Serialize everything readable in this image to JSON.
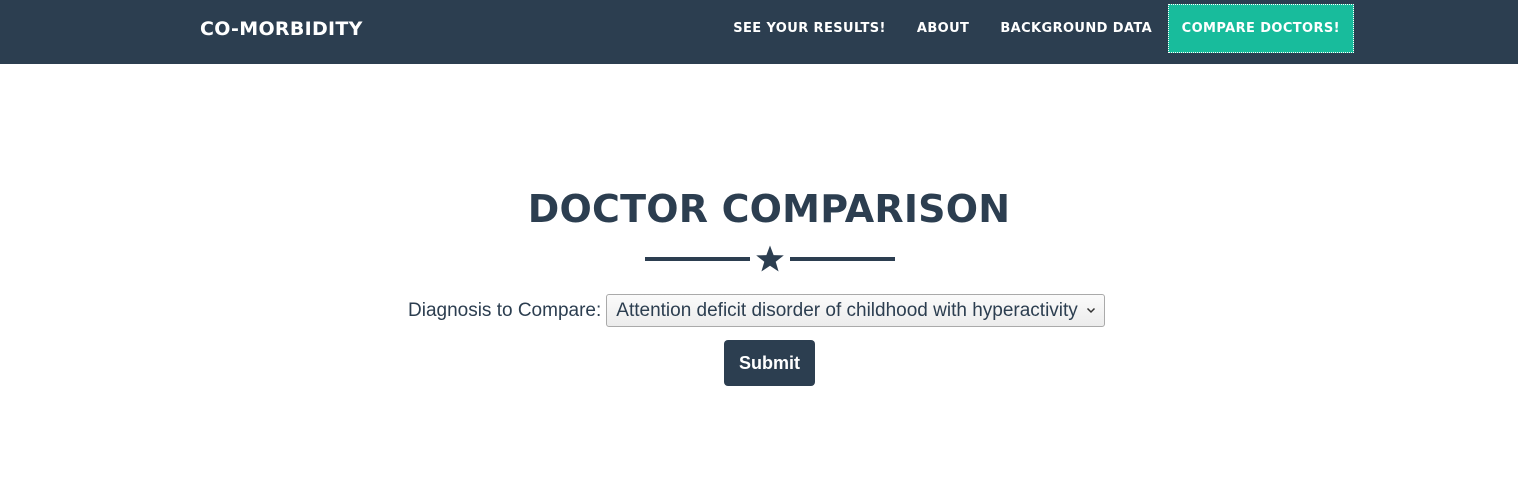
{
  "navbar": {
    "brand": "CO-MORBIDITY",
    "items": [
      {
        "label": "SEE YOUR RESULTS!",
        "active": false
      },
      {
        "label": "ABOUT",
        "active": false
      },
      {
        "label": "BACKGROUND DATA",
        "active": false
      },
      {
        "label": "COMPARE DOCTORS!",
        "active": true
      }
    ]
  },
  "main": {
    "title": "DOCTOR COMPARISON",
    "divider_icon": "star-icon",
    "form": {
      "label": "Diagnosis to Compare:",
      "selected_diagnosis": "Attention deficit disorder of childhood with hyperactivity",
      "submit_label": "Submit"
    }
  },
  "colors": {
    "primary": "#2c3e50",
    "accent": "#18bc9c",
    "background": "#ffffff"
  }
}
